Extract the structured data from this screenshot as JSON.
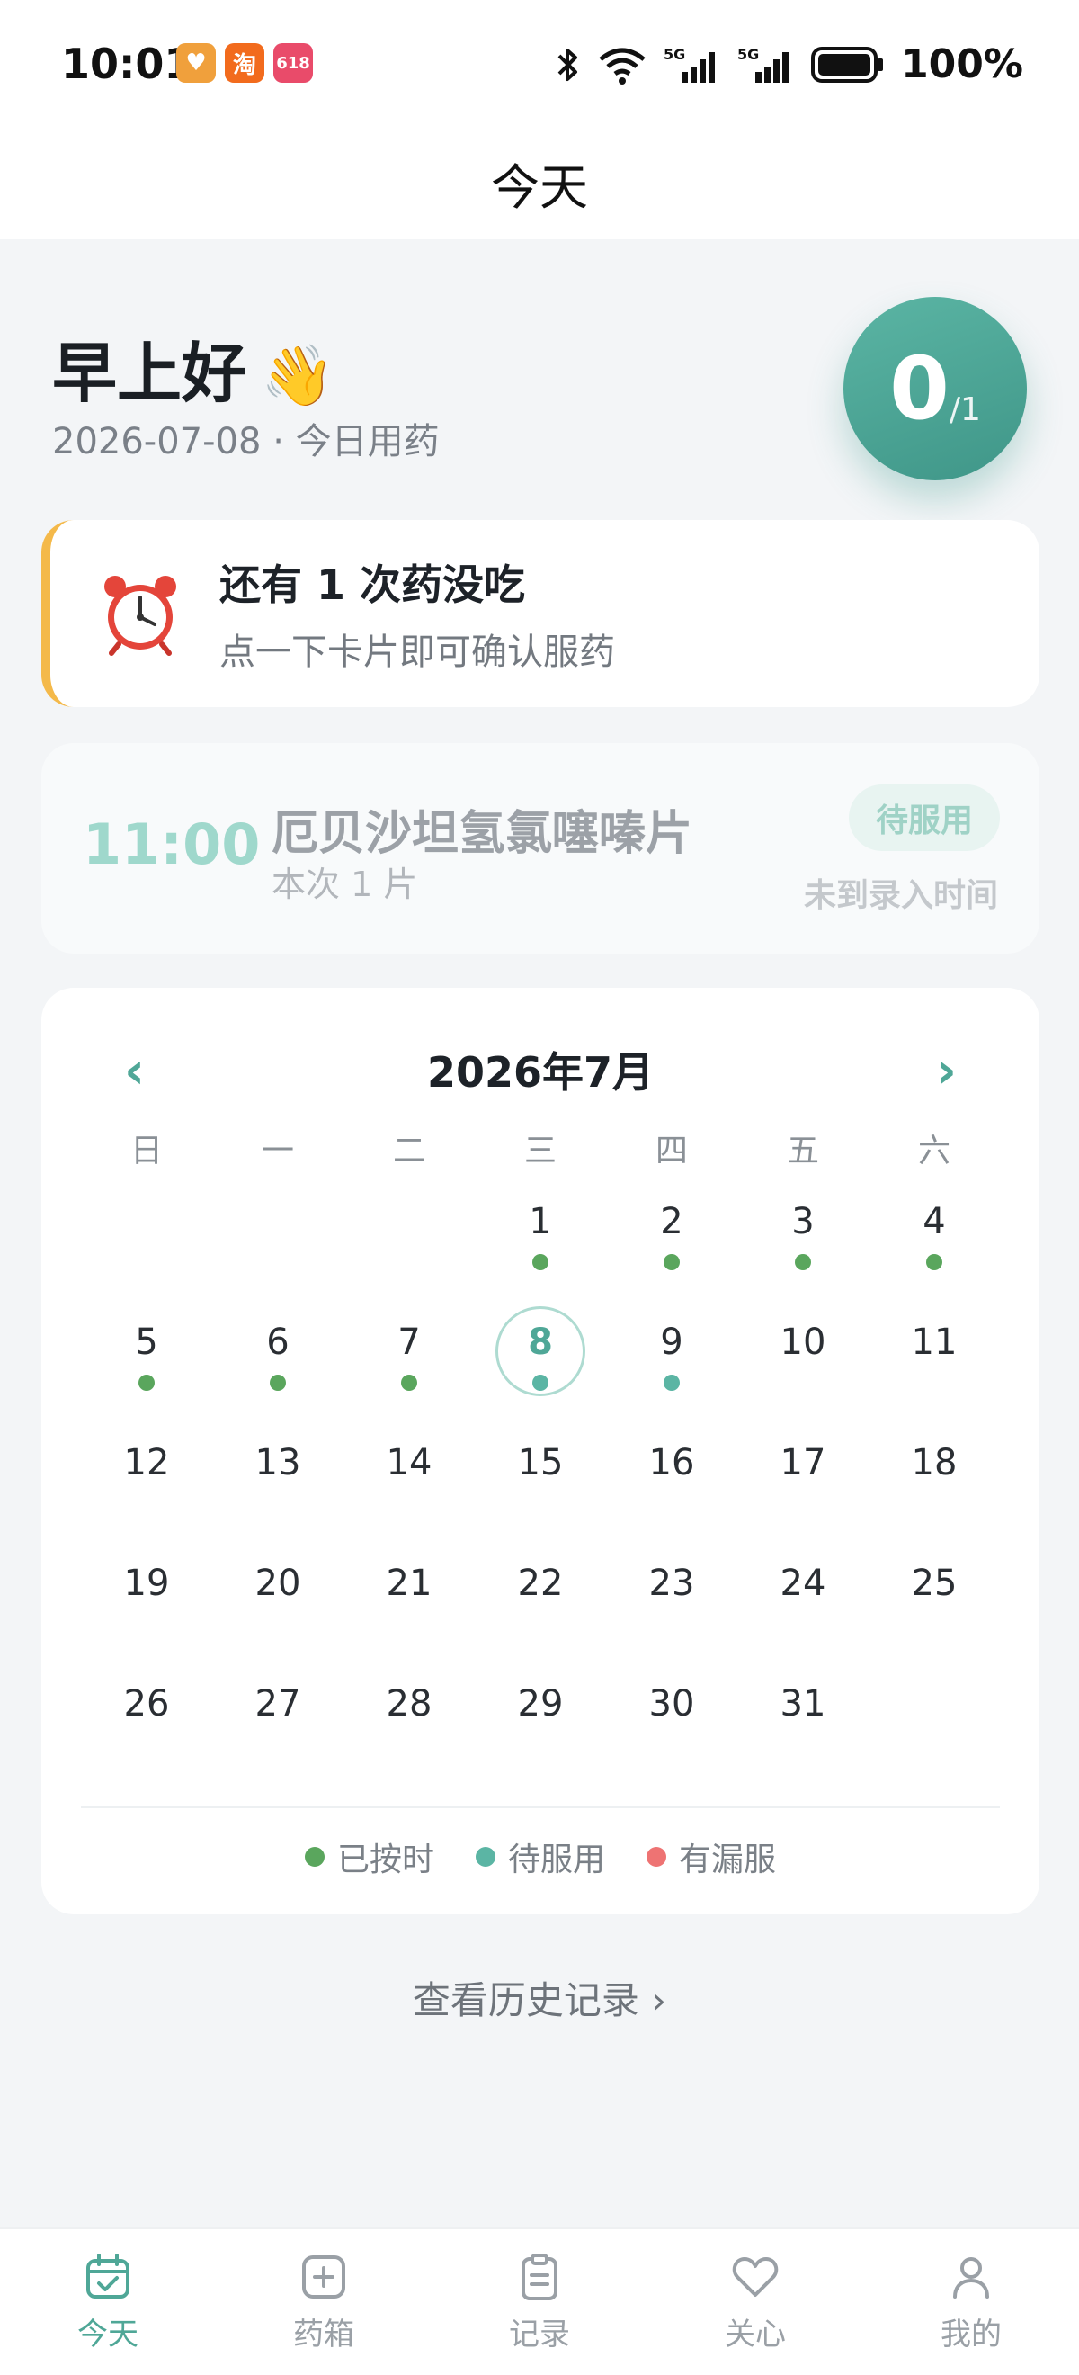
{
  "status_bar": {
    "time": "10:01",
    "battery": "100%",
    "app_icons": [
      {
        "name": "heart-app-icon",
        "glyph": "♥",
        "color": "#f0a03c"
      },
      {
        "name": "taobao-app-icon",
        "glyph": "淘",
        "color": "#f26b1d"
      },
      {
        "name": "618-app-icon",
        "glyph": "618",
        "color": "#e94b6a"
      }
    ]
  },
  "header": {
    "title": "今天"
  },
  "greeting": {
    "text": "早上好",
    "emoji": "👋",
    "date": "2026-07-08",
    "separator": "·",
    "subtitle": "今日用药"
  },
  "progress": {
    "taken": "0",
    "total": "/1"
  },
  "reminder": {
    "title": "还有 1 次药没吃",
    "subtitle": "点一下卡片即可确认服药"
  },
  "dose": {
    "time": "11:00",
    "name": "厄贝沙坦氢氯噻嗪片",
    "quantity": "本次 1 片",
    "status": "待服用",
    "note": "未到录入时间"
  },
  "calendar": {
    "title": "2026年7月",
    "prev": "‹",
    "next": "›",
    "weekdays": [
      "日",
      "一",
      "二",
      "三",
      "四",
      "五",
      "六"
    ],
    "first_weekday_index": 3,
    "days": [
      {
        "d": "1",
        "status": "taken"
      },
      {
        "d": "2",
        "status": "taken"
      },
      {
        "d": "3",
        "status": "taken"
      },
      {
        "d": "4",
        "status": "taken"
      },
      {
        "d": "5",
        "status": "taken"
      },
      {
        "d": "6",
        "status": "taken"
      },
      {
        "d": "7",
        "status": "taken"
      },
      {
        "d": "8",
        "status": "pending",
        "today": true
      },
      {
        "d": "9",
        "status": "pending"
      },
      {
        "d": "10"
      },
      {
        "d": "11"
      },
      {
        "d": "12"
      },
      {
        "d": "13"
      },
      {
        "d": "14"
      },
      {
        "d": "15"
      },
      {
        "d": "16"
      },
      {
        "d": "17"
      },
      {
        "d": "18"
      },
      {
        "d": "19"
      },
      {
        "d": "20"
      },
      {
        "d": "21"
      },
      {
        "d": "22"
      },
      {
        "d": "23"
      },
      {
        "d": "24"
      },
      {
        "d": "25"
      },
      {
        "d": "26"
      },
      {
        "d": "27"
      },
      {
        "d": "28"
      },
      {
        "d": "29"
      },
      {
        "d": "30"
      },
      {
        "d": "31"
      }
    ],
    "legend": [
      {
        "key": "taken",
        "label": "已按时",
        "color": "#5aa65d"
      },
      {
        "key": "pending",
        "label": "待服用",
        "color": "#5bb5a4"
      },
      {
        "key": "missed",
        "label": "有漏服",
        "color": "#ee7373"
      }
    ]
  },
  "history_link": "查看历史记录 ›",
  "bottom_nav": [
    {
      "label": "今天",
      "icon": "calendar-check-icon",
      "active": true
    },
    {
      "label": "药箱",
      "icon": "medicine-box-icon",
      "active": false
    },
    {
      "label": "记录",
      "icon": "clipboard-icon",
      "active": false
    },
    {
      "label": "关心",
      "icon": "heart-icon",
      "active": false
    },
    {
      "label": "我的",
      "icon": "user-icon",
      "active": false
    }
  ],
  "colors": {
    "accent": "#4fa797",
    "reminder_bar": "#f4b94a",
    "background": "#f3f5f7"
  }
}
